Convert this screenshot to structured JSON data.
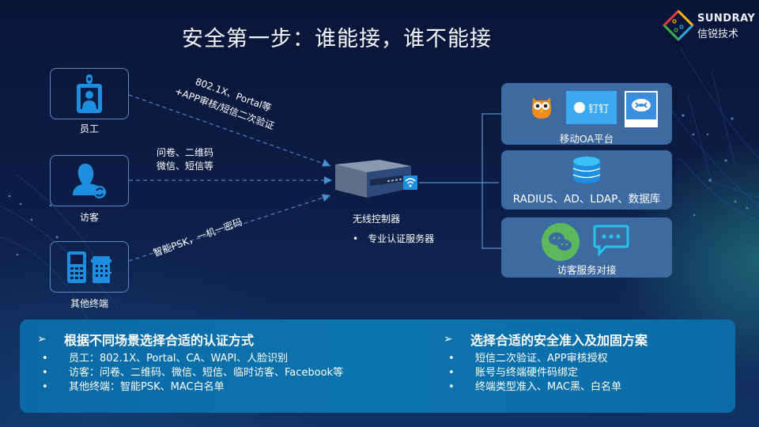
{
  "slide": {
    "title": "安全第一步：谁能接，谁不能接",
    "logo": {
      "brand": "SUNDRAY",
      "brand_cn": "信锐技术"
    }
  },
  "endpoints": [
    {
      "label": "员工",
      "icon": "employee-badge-icon"
    },
    {
      "label": "访客",
      "icon": "visitor-icon"
    },
    {
      "label": "其他终端",
      "icon": "terminal-devices-icon"
    }
  ],
  "flows": {
    "employee": {
      "line1": "802.1X、Portal等",
      "line2": "+APP审核/短信二次验证"
    },
    "visitor": {
      "line1": "问卷、二维码",
      "line2": "微信、短信等"
    },
    "other": {
      "line1": "智能PSK，一机一密码"
    }
  },
  "controller": {
    "title": "无线控制器",
    "bullet_symbol": "•",
    "bullet": "专业认证服务器",
    "icon": "wifi-icon"
  },
  "panels": [
    {
      "label": "移动OA平台",
      "icons": [
        "owl-app-icon",
        "dingtalk-icon",
        "wecom-icon"
      ],
      "dingtalk_text": "钉钉"
    },
    {
      "label": "RADIUS、AD、LDAP、数据库",
      "icons": [
        "database-icon"
      ]
    },
    {
      "label": "访客服务对接",
      "icons": [
        "wechat-icon",
        "chat-bubble-icon"
      ]
    }
  ],
  "summary": {
    "arrow": "➢",
    "bullet": "•",
    "left": {
      "heading": "根据不同场景选择合适的认证方式",
      "items": [
        "员工：802.1X、Portal、CA、WAPI、人脸识别",
        "访客：问卷、二维码、微信、短信、临时访客、Facebook等",
        "其他终端：智能PSK、MAC白名单"
      ]
    },
    "right": {
      "heading": "选择合适的安全准入及加固方案",
      "items": [
        "短信二次验证、APP审核授权",
        "账号与终端硬件码绑定",
        "终端类型准入、MAC黑、白名单"
      ]
    }
  },
  "colors": {
    "accent_blue": "#1e8fe0",
    "panel_blue": "#3d6aa0",
    "summary_blue": "#0b70ad",
    "wechat_green": "#5cb85c",
    "chat_cyan": "#22c3ee"
  }
}
